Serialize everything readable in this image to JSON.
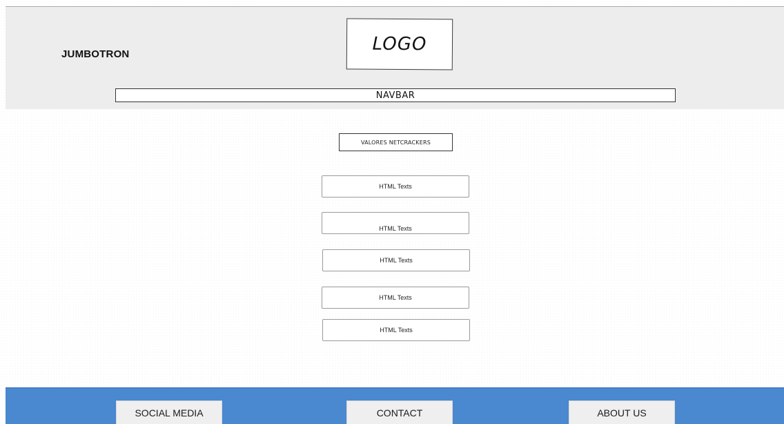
{
  "header": {
    "jumbotron_label": "JUMBOTRON",
    "logo_label": "LOGO",
    "navbar_label": "NAVBAR"
  },
  "main": {
    "values_label": "VALORES NETCRACKERS",
    "text_boxes": [
      {
        "label": "HTML Texts"
      },
      {
        "label": "HTML Texts"
      },
      {
        "label": "HTML Texts"
      },
      {
        "label": "HTML Texts"
      },
      {
        "label": "HTML Texts"
      }
    ]
  },
  "footer": {
    "social_label": "SOCIAL MEDIA",
    "contact_label": "CONTACT",
    "about_label": "ABOUT US"
  },
  "colors": {
    "jumbotron_bg": "#ededed",
    "footer_bg": "#4a88cf",
    "footer_button_bg": "#efefef"
  }
}
